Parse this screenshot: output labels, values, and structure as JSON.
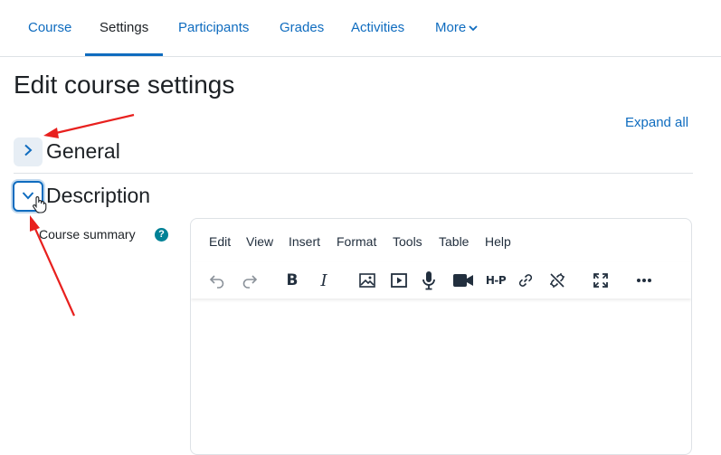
{
  "nav": {
    "tabs": [
      {
        "label": "Course"
      },
      {
        "label": "Settings",
        "active": true
      },
      {
        "label": "Participants"
      },
      {
        "label": "Grades"
      },
      {
        "label": "Activities"
      },
      {
        "label": "More"
      }
    ]
  },
  "page": {
    "title": "Edit course settings",
    "expand_all": "Expand all"
  },
  "sections": {
    "general": {
      "title": "General",
      "expanded": false
    },
    "description": {
      "title": "Description",
      "expanded": true
    }
  },
  "field": {
    "label": "Course summary",
    "help": "?"
  },
  "editor": {
    "menu": [
      "Edit",
      "View",
      "Insert",
      "Format",
      "Tools",
      "Table",
      "Help"
    ],
    "toolbar": {
      "bold": "B",
      "italic": "I",
      "h5p": "H-P",
      "icons": [
        "undo-icon",
        "redo-icon",
        "bold-icon",
        "italic-icon",
        "image-icon",
        "media-icon",
        "microphone-icon",
        "video-camera-icon",
        "h5p-icon",
        "link-icon",
        "unlink-icon",
        "fullscreen-icon",
        "more-icon"
      ]
    },
    "content": ""
  },
  "colors": {
    "accent": "#0f6cbf",
    "help": "#008196",
    "annotation_arrow": "#e8201e"
  }
}
